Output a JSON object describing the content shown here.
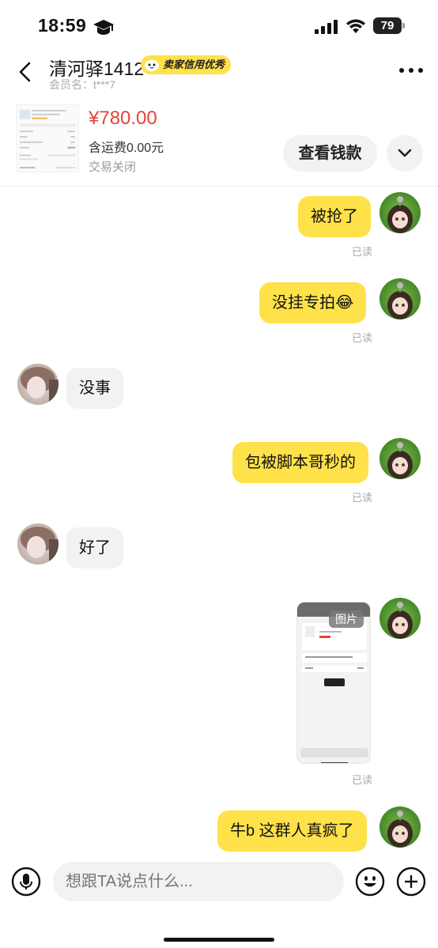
{
  "status_bar": {
    "time": "18:59",
    "battery": "79"
  },
  "header": {
    "contact_name": "清河驿1412",
    "credit_badge": "卖家信用优秀",
    "member_label": "会员名：t***7"
  },
  "order": {
    "price": "¥780.00",
    "shipping": "含运费0.00元",
    "status": "交易关闭",
    "view_money_label": "查看钱款"
  },
  "messages": [
    {
      "side": "me",
      "text": "被抢了",
      "read": "已读"
    },
    {
      "side": "me",
      "text": "没挂专拍😂",
      "read": "已读"
    },
    {
      "side": "them",
      "text": "没事"
    },
    {
      "side": "me",
      "text": "包被脚本哥秒的",
      "read": "已读"
    },
    {
      "side": "them",
      "text": "好了"
    },
    {
      "side": "me",
      "type": "image",
      "image_label": "图片",
      "read": "已读"
    },
    {
      "side": "me",
      "text": "牛b 这群人真疯了"
    }
  ],
  "input": {
    "placeholder": "想跟TA说点什么..."
  },
  "colors": {
    "accent_yellow": "#ffe14a",
    "price_red": "#e6433a",
    "bubble_gray": "#f2f2f2"
  }
}
